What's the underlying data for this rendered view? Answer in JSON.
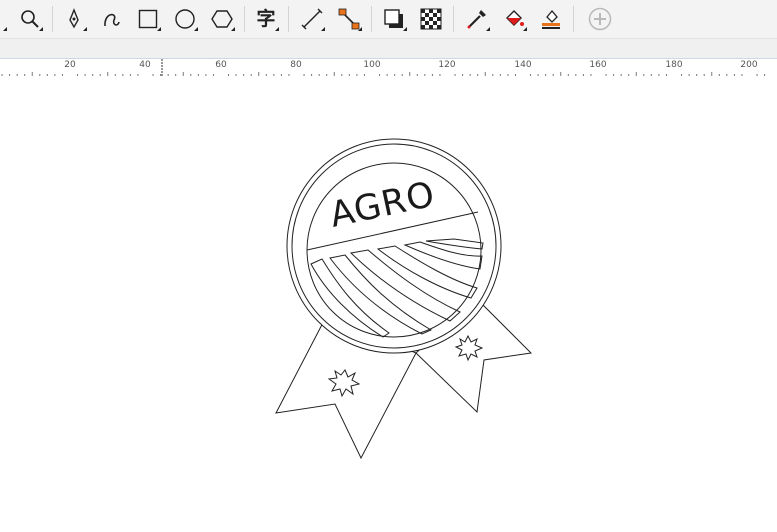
{
  "toolbar": {
    "tools": [
      {
        "name": "zoom-tool",
        "icon": "magnifier-icon"
      },
      {
        "name": "pen-tool",
        "icon": "pen-nib-icon"
      },
      {
        "name": "bezier-tool",
        "icon": "curve-icon"
      },
      {
        "name": "rectangle-tool",
        "icon": "rectangle-icon"
      },
      {
        "name": "ellipse-tool",
        "icon": "ellipse-icon"
      },
      {
        "name": "polygon-tool",
        "icon": "hexagon-icon"
      },
      {
        "name": "text-tool",
        "icon": "text-icon",
        "glyph": "字"
      },
      {
        "name": "dimension-tool",
        "icon": "dimension-line-icon"
      },
      {
        "name": "connector-tool",
        "icon": "connector-icon"
      },
      {
        "name": "drop-shadow-tool",
        "icon": "shadow-icon"
      },
      {
        "name": "transparency-tool",
        "icon": "checker-icon"
      },
      {
        "name": "eyedropper-tool",
        "icon": "eyedropper-icon"
      },
      {
        "name": "interactive-fill-tool",
        "icon": "fill-bucket-icon"
      },
      {
        "name": "smart-fill-tool",
        "icon": "smart-fill-icon"
      },
      {
        "name": "add-tool",
        "icon": "plus-circle-icon"
      }
    ]
  },
  "ruler": {
    "labels": [
      "20",
      "40",
      "60",
      "80",
      "100",
      "120",
      "140",
      "160",
      "180",
      "200"
    ]
  },
  "canvas": {
    "logo_text": "AGRO"
  },
  "colors": {
    "accent_red": "#e01b1b",
    "accent_orange": "#e8731a",
    "stroke": "#222222",
    "ruler_border": "#cfd6e4"
  }
}
